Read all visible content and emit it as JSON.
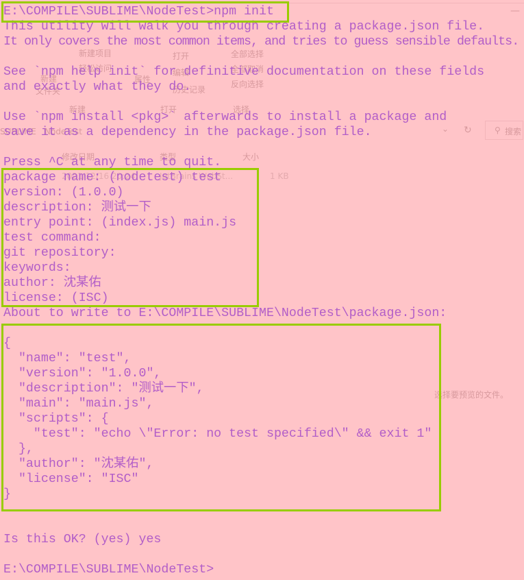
{
  "background_explorer": {
    "ribbon": [
      "新建项目",
      "轻松访问",
      "新建",
      "文件夹",
      "打开",
      "编辑",
      "历史记录",
      "属性",
      "全部选择",
      "全部取消",
      "反向选择"
    ],
    "groups": [
      "新建",
      "打开",
      "选择"
    ],
    "breadcrumb": [
      "SUBLIME",
      "NodeTest"
    ],
    "search_placeholder": "搜索",
    "columns": [
      "修改日期",
      "类型",
      "大小"
    ],
    "file_row": {
      "date": "2021/12/16 20:24",
      "type": "JetBrains WebSt...",
      "size": "1 KB"
    },
    "preview_text": "选择要预览的文件。"
  },
  "terminal": {
    "text_color": "#b25ec8",
    "background_color": "#ffc4c8",
    "highlight_color": "#99cc00",
    "lines": [
      "E:\\COMPILE\\SUBLIME\\NodeTest>npm init",
      "This utility will walk you through creating a package.json file.",
      "It only covers the most common items, and tries to guess sensible defaults.",
      "",
      "See `npm help init` for definitive documentation on these fields",
      "and exactly what they do.",
      "",
      "Use `npm install <pkg>` afterwards to install a package and",
      "save it as a dependency in the package.json file.",
      "",
      "Press ^C at any time to quit.",
      "package name: (nodetest) test",
      "version: (1.0.0)",
      "description: 测试一下",
      "entry point: (index.js) main.js",
      "test command:",
      "git repository:",
      "keywords:",
      "author: 沈某佑",
      "license: (ISC)",
      "About to write to E:\\COMPILE\\SUBLIME\\NodeTest\\package.json:",
      "",
      "{",
      "  \"name\": \"test\",",
      "  \"version\": \"1.0.0\",",
      "  \"description\": \"测试一下\",",
      "  \"main\": \"main.js\",",
      "  \"scripts\": {",
      "    \"test\": \"echo \\\"Error: no test specified\\\" && exit 1\"",
      "  },",
      "  \"author\": \"沈某佑\",",
      "  \"license\": \"ISC\"",
      "}",
      "",
      "",
      "Is this OK? (yes) yes",
      "",
      "E:\\COMPILE\\SUBLIME\\NodeTest>"
    ]
  }
}
